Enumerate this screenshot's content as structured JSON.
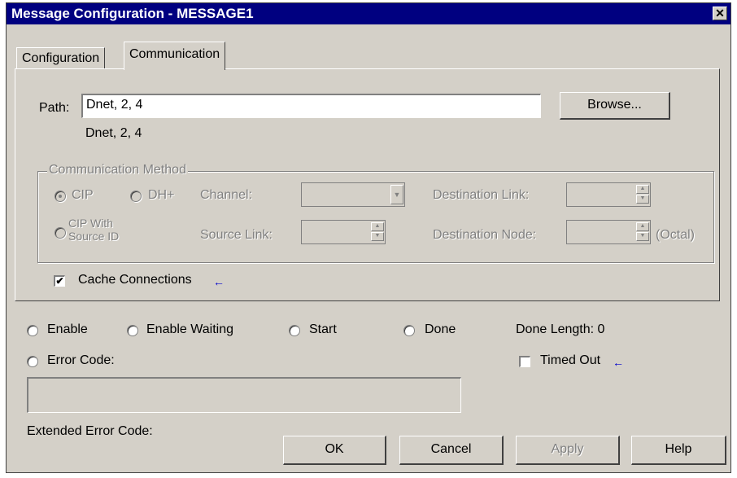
{
  "window": {
    "title": "Message Configuration - MESSAGE1",
    "close_glyph": "✕"
  },
  "tabs": [
    {
      "label": "Configuration"
    },
    {
      "label": "Communication"
    }
  ],
  "path": {
    "label": "Path:",
    "value": "Dnet, 2, 4",
    "display": "Dnet, 2, 4",
    "browse_label": "Browse..."
  },
  "comm_method": {
    "title": "Communication Method",
    "cip": "CIP",
    "dhplus": "DH+",
    "channel": "Channel:",
    "dest_link": "Destination Link:",
    "cip_with_source_id_1": "CIP With",
    "cip_with_source_id_2": "Source ID",
    "source_link": "Source Link:",
    "dest_node": "Destination Node:",
    "octal": "(Octal)"
  },
  "cache_connections": {
    "label": "Cache Connections",
    "checked": true,
    "check_glyph": "✔",
    "arrow": "←"
  },
  "status": {
    "enable": "Enable",
    "enable_waiting": "Enable Waiting",
    "start": "Start",
    "done": "Done",
    "done_length": "Done Length: 0",
    "error_code": "Error Code:",
    "timed_out": "Timed Out",
    "timed_out_arrow": "←",
    "extended_error_code": "Extended Error Code:"
  },
  "buttons": {
    "ok": "OK",
    "cancel": "Cancel",
    "apply": "Apply",
    "help": "Help"
  }
}
